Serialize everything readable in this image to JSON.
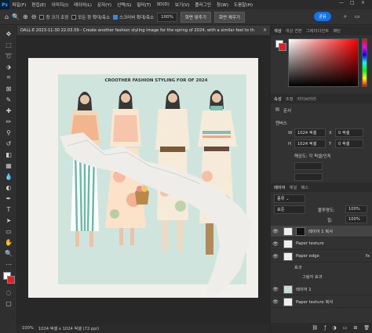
{
  "app": {
    "logo": "Ps",
    "window_controls": [
      "—",
      "□",
      "×"
    ]
  },
  "menu": [
    "파일(F)",
    "편집(E)",
    "이미지(I)",
    "레이어(L)",
    "문자(Y)",
    "선택(S)",
    "필터(T)",
    "3D(D)",
    "보기(V)",
    "플러그인",
    "창(W)",
    "도움말(H)"
  ],
  "options": {
    "resize_windows": "창 크기 조정",
    "zoom_all": "모든 창 확대/축소",
    "scrubby_zoom": "스크러비 확대/축소",
    "zoom_value": "100%",
    "fit_screen": "화면 맞추기",
    "fill_screen": "화면 채우기",
    "share": "공유"
  },
  "document": {
    "tab_title": "DALL·E 2023-11-30 22.03.59 - Create another fashion styling image for the spring of 2024, with a similar feel to th",
    "art_title": "CROOTHER FASHION STYLING FOR OF 2024"
  },
  "status": {
    "zoom": "100%",
    "info": "1024 픽셀 x 1024 픽셀 (72 ppi)"
  },
  "color_panel": {
    "tabs": [
      "색상",
      "색상 견본",
      "그레이디언트",
      "패턴"
    ],
    "hue_color": "#ff0000"
  },
  "properties": {
    "tabs": [
      "속성",
      "조정",
      "라이브러리"
    ],
    "doc_label": "문서",
    "canvas_label": "캔버스",
    "width": "1024 픽셀",
    "height": "1024 픽셀",
    "x_value": "0 픽셀",
    "y_value": "0 픽셀",
    "resolution": "해상도: 각 픽셀/인치"
  },
  "layers_panel": {
    "tabs": [
      "레이어",
      "채널",
      "패스"
    ],
    "kind": "종류",
    "blend_mode": "표준",
    "opacity_label": "불투명도:",
    "opacity": "100%",
    "fill_label": "칠:",
    "fill": "100%",
    "layers": [
      {
        "name": "레이어 1 복사",
        "visible": true,
        "selected": true
      },
      {
        "name": "Paper texture",
        "visible": true
      },
      {
        "name": "Paper edge",
        "visible": true,
        "fx": "fx"
      },
      {
        "name": "레이어 1",
        "visible": true
      },
      {
        "name": "Paper texture 복사",
        "visible": true
      }
    ],
    "effects_label": "효과",
    "effect_name": "그림자 효과"
  },
  "colors": {
    "foreground": "#ffffff",
    "background": "#e41e26",
    "accent": "#1473e6"
  }
}
